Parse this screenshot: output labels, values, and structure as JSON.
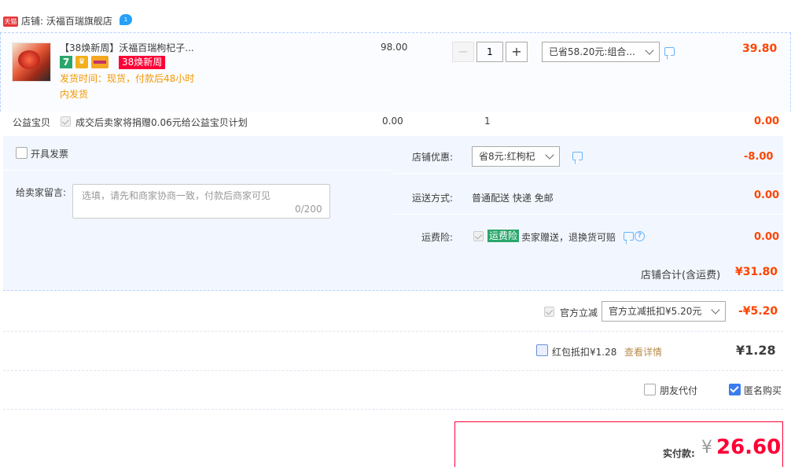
{
  "store": {
    "badge": "天猫",
    "name": "店铺: 沃福百瑞旗舰店"
  },
  "item": {
    "title": "【38焕新周】沃福百瑞枸杞子...",
    "badge7": "7",
    "promo_tag": "38焕新周",
    "ship_time": "发货时间：现货，付款后48小时内发货",
    "price": "98.00",
    "quantity": "1",
    "minus_label": "−",
    "plus_label": "+",
    "combo_discount": "已省58.20元:组合...",
    "total": "39.80"
  },
  "charity": {
    "label": "公益宝贝",
    "text": "成交后卖家将捐赠0.06元给公益宝贝计划",
    "price": "0.00",
    "quantity": "1",
    "total": "0.00"
  },
  "invoice": {
    "label": "开具发票"
  },
  "message": {
    "label": "给卖家留言:",
    "placeholder": "选填，请先和商家协商一致，付款后商家可见",
    "count": "0/200"
  },
  "store_discount": {
    "label": "店铺优惠:",
    "selected": "省8元:红枸杞",
    "value": "-8.00"
  },
  "shipping": {
    "label": "运送方式:",
    "text": "普通配送 快递 免邮",
    "value": "0.00"
  },
  "insurance": {
    "label": "运费险:",
    "tag": "运费险",
    "text": "卖家赠送，退换货可赔",
    "value": "0.00"
  },
  "store_sum": {
    "label": "店铺合计(含运费)",
    "value": "¥31.80"
  },
  "gov_discount": {
    "label": "官方立减",
    "selected": "官方立减抵扣¥5.20元",
    "value": "-¥5.20"
  },
  "red_packet": {
    "label": "红包抵扣¥1.28",
    "link": "查看详情",
    "value": "¥1.28"
  },
  "friend_pay": {
    "label": "朋友代付"
  },
  "anonymous": {
    "label": "匿名购买"
  },
  "payment": {
    "label": "实付款:",
    "currency": "¥",
    "amount": "26.60"
  },
  "colors": {
    "accent_red": "#ff0036",
    "price_orange": "#ff4400",
    "row_blue": "#f2f7ff",
    "check_blue": "#3a7cf0"
  }
}
